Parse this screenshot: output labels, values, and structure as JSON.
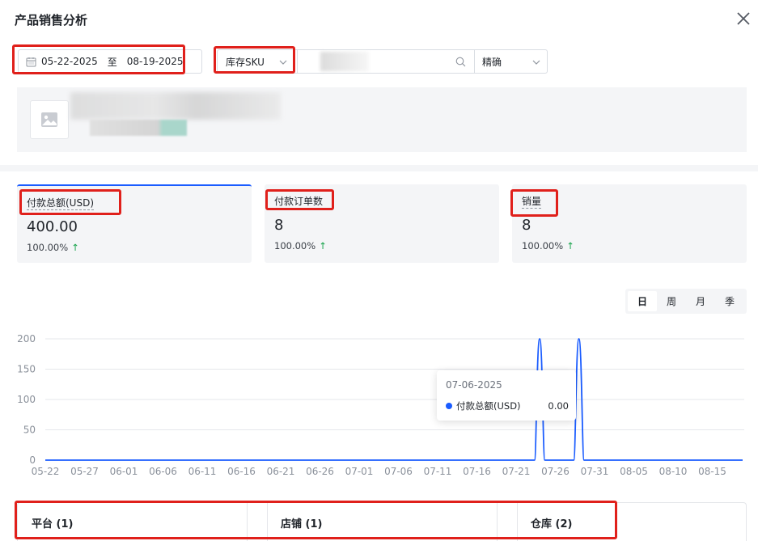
{
  "header": {
    "title": "产品销售分析"
  },
  "filters": {
    "date_start": "05-22-2025",
    "date_separator": "至",
    "date_end": "08-19-2025",
    "sku_type": "库存SKU",
    "match_mode": "精确"
  },
  "stats": [
    {
      "label": "付款总额(USD)",
      "value": "400.00",
      "delta": "100.00%"
    },
    {
      "label": "付款订单数",
      "value": "8",
      "delta": "100.00%"
    },
    {
      "label": "销量",
      "value": "8",
      "delta": "100.00%"
    }
  ],
  "period_tabs": [
    "日",
    "周",
    "月",
    "季"
  ],
  "tooltip": {
    "date": "07-06-2025",
    "series": "付款总额(USD)",
    "value": "0.00"
  },
  "bottom_tabs": [
    "平台 (1)",
    "店铺 (1)",
    "仓库 (2)"
  ],
  "colors": {
    "accent": "#1a5cff",
    "highlight": "#e0201b",
    "up": "#16a34a"
  },
  "chart_data": {
    "type": "line",
    "x_ticks": [
      "05-22",
      "05-27",
      "06-01",
      "06-06",
      "06-11",
      "06-16",
      "06-21",
      "06-26",
      "07-01",
      "07-06",
      "07-11",
      "07-16",
      "07-21",
      "07-26",
      "07-31",
      "08-05",
      "08-10",
      "08-15"
    ],
    "y_ticks": [
      0,
      50,
      100,
      150,
      200
    ],
    "ylim": [
      0,
      200
    ],
    "series": [
      {
        "name": "付款总额(USD)",
        "points": [
          [
            "07-24",
            200
          ],
          [
            "07-29",
            200
          ]
        ]
      }
    ],
    "grid": true
  }
}
